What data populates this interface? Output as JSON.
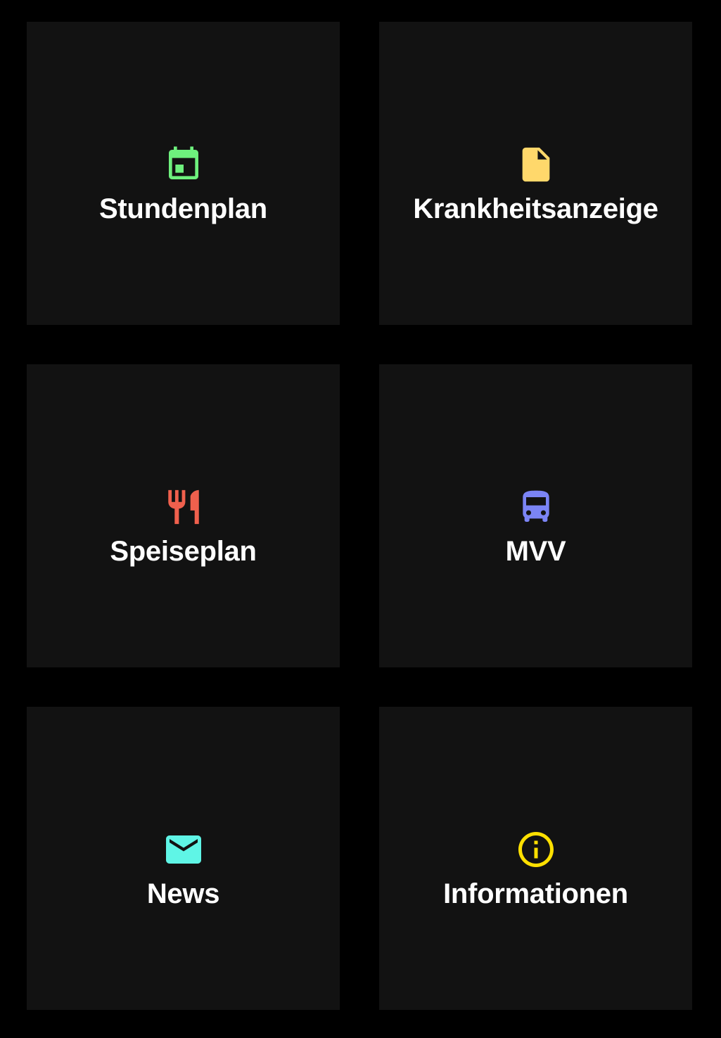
{
  "tiles": [
    {
      "label": "Stundenplan",
      "icon": "calendar-icon",
      "color": "#6ef07d"
    },
    {
      "label": "Krankheitsanzeige",
      "icon": "document-icon",
      "color": "#ffd86b"
    },
    {
      "label": "Speiseplan",
      "icon": "restaurant-icon",
      "color": "#f0604d"
    },
    {
      "label": "MVV",
      "icon": "bus-icon",
      "color": "#7b84f5"
    },
    {
      "label": "News",
      "icon": "mail-icon",
      "color": "#5ff5e6"
    },
    {
      "label": "Informationen",
      "icon": "info-icon",
      "color": "#ffe000"
    }
  ]
}
